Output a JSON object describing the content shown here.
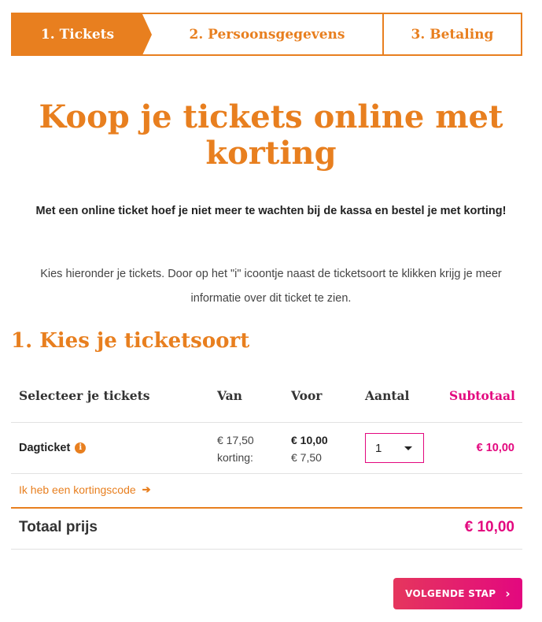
{
  "stepper": {
    "steps": [
      {
        "label": "1. Tickets"
      },
      {
        "label": "2. Persoonsgegevens"
      },
      {
        "label": "3. Betaling"
      }
    ]
  },
  "page": {
    "headline": "Koop je tickets online met korting",
    "intro_bold": "Met een online ticket hoef je niet meer te wachten bij de kassa en bestel je met korting!",
    "intro": "Kies hieronder je tickets. Door op het \"i\" icoontje naast de ticketsoort te klikken krijg je meer informatie over dit ticket te zien.",
    "section_title": "1. Kies je ticketsoort"
  },
  "table": {
    "headers": {
      "ticket": "Selecteer je tickets",
      "van": "Van",
      "voor": "Voor",
      "aantal": "Aantal",
      "subtotaal": "Subtotaal"
    },
    "rows": [
      {
        "name": "Dagticket",
        "info_icon": "i",
        "van_price": "€ 17,50",
        "korting_label": "korting:",
        "voor_price": "€ 10,00",
        "korting_value": "€ 7,50",
        "quantity": "1",
        "subtotal": "€ 10,00"
      }
    ]
  },
  "discount": {
    "link_label": "Ik heb een kortingscode",
    "icon": "arrow-right-icon"
  },
  "total": {
    "label": "Totaal prijs",
    "value": "€ 10,00"
  },
  "actions": {
    "next_label": "VOLGENDE STAP",
    "next_icon": "chevron-right-icon"
  },
  "colors": {
    "accent_orange": "#e87f1f",
    "accent_pink": "#e3087f"
  }
}
